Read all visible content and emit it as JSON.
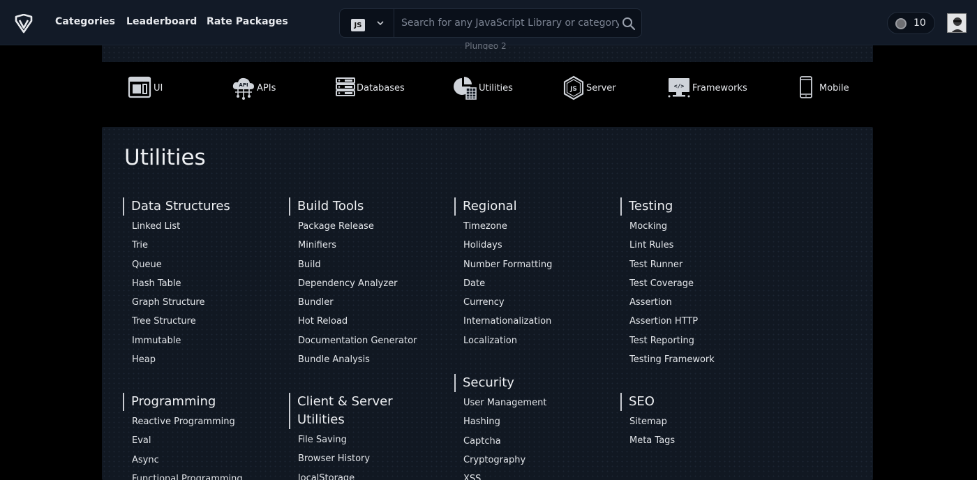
{
  "nav": {
    "links": [
      "Categories",
      "Leaderboard",
      "Rate Packages"
    ],
    "language": "JS",
    "search_placeholder": "Search for any JavaScript Library or category",
    "points": "10"
  },
  "strip_text": "Plungeo 2",
  "categories": [
    "UI",
    "APIs",
    "Databases",
    "Utilities",
    "Server",
    "Frameworks",
    "Mobile"
  ],
  "category_icons": [
    "ui-icon",
    "api-cloud-icon",
    "database-icon",
    "utilities-icon",
    "nodejs-icon",
    "frameworks-icon",
    "mobile-icon"
  ],
  "panel": {
    "title": "Utilities",
    "groups": [
      {
        "title": "Data Structures",
        "items": [
          "Linked List",
          "Trie",
          "Queue",
          "Hash Table",
          "Graph Structure",
          "Tree Structure",
          "Immutable",
          "Heap"
        ]
      },
      {
        "title": "Build Tools",
        "items": [
          "Package Release",
          "Minifiers",
          "Build",
          "Dependency Analyzer",
          "Bundler",
          "Hot Reload",
          "Documentation Generator",
          "Bundle Analysis"
        ]
      },
      {
        "title": "Regional",
        "items": [
          "Timezone",
          "Holidays",
          "Number Formatting",
          "Date",
          "Currency",
          "Internationalization",
          "Localization"
        ]
      },
      {
        "title": "Testing",
        "items": [
          "Mocking",
          "Lint Rules",
          "Test Runner",
          "Test Coverage",
          "Assertion",
          "Assertion HTTP",
          "Test Reporting",
          "Testing Framework"
        ]
      },
      {
        "title": "Programming",
        "items": [
          "Reactive Programming",
          "Eval",
          "Async",
          "Functional Programming"
        ]
      },
      {
        "title": "Client & Server Utilities",
        "items": [
          "File Saving",
          "Browser History",
          "localStorage"
        ]
      },
      {
        "title": "Security",
        "items": [
          "User Management",
          "Hashing",
          "Captcha",
          "Cryptography",
          "XSS"
        ]
      },
      {
        "title": "SEO",
        "items": [
          "Sitemap",
          "Meta Tags"
        ]
      }
    ]
  }
}
